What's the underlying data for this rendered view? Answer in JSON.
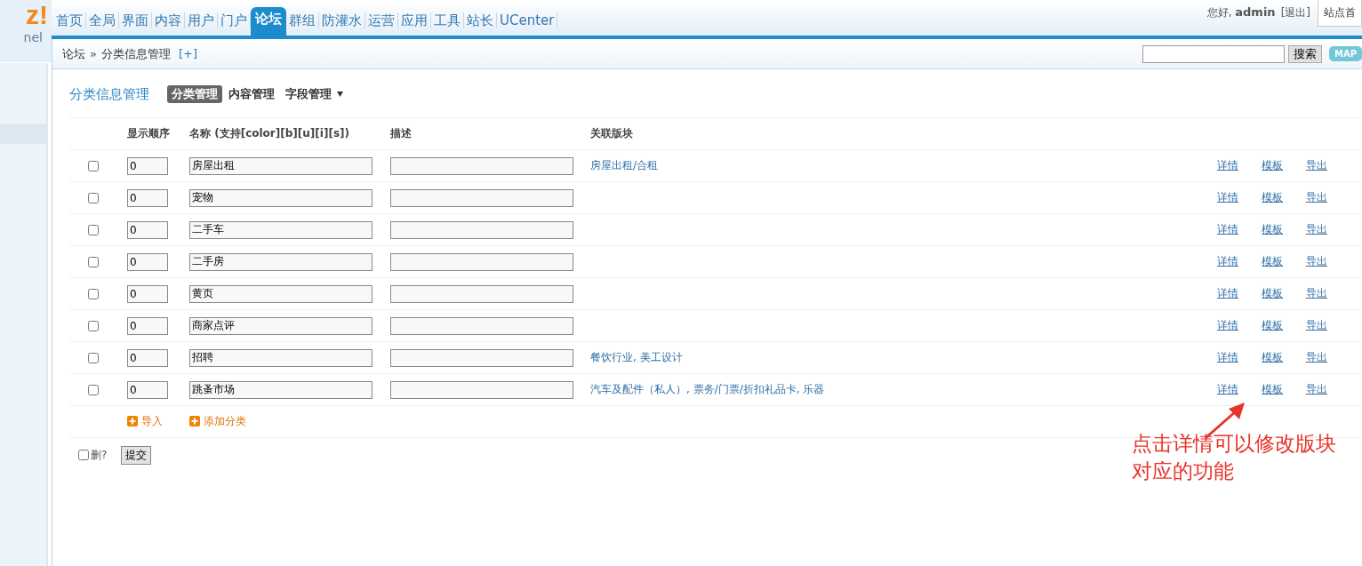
{
  "header": {
    "logo": "z!",
    "logo_subtitle": "nel",
    "nav": [
      {
        "label": "首页",
        "selected": false
      },
      {
        "label": "全局",
        "selected": false
      },
      {
        "label": "界面",
        "selected": false
      },
      {
        "label": "内容",
        "selected": false
      },
      {
        "label": "用户",
        "selected": false
      },
      {
        "label": "门户",
        "selected": false
      },
      {
        "label": "论坛",
        "selected": true
      },
      {
        "label": "群组",
        "selected": false
      },
      {
        "label": "防灌水",
        "selected": false
      },
      {
        "label": "运营",
        "selected": false
      },
      {
        "label": "应用",
        "selected": false
      },
      {
        "label": "工具",
        "selected": false
      },
      {
        "label": "站长",
        "selected": false
      },
      {
        "label": "UCenter",
        "selected": false
      }
    ],
    "greeting": "您好,",
    "user": "admin",
    "logout": "[退出]",
    "site_home": "站点首"
  },
  "breadcrumb": {
    "items": [
      "论坛",
      "分类信息管理"
    ],
    "separator": "»",
    "add": "[+]"
  },
  "search": {
    "button": "搜索",
    "map": "MAP"
  },
  "page": {
    "title": "分类信息管理",
    "tabs": [
      {
        "label": "分类管理",
        "selected": true,
        "dropdown": false
      },
      {
        "label": "内容管理",
        "selected": false,
        "dropdown": false
      },
      {
        "label": "字段管理",
        "selected": false,
        "dropdown": true
      }
    ]
  },
  "table": {
    "columns": [
      "显示顺序",
      "**名称** (支持[color][b][u][i][s])",
      "描述",
      "关联版块"
    ],
    "rows": [
      {
        "checked": false,
        "order": "0",
        "name": "房屋出租",
        "forums": "房屋出租/合租",
        "actions": [
          "详情",
          "模板",
          "导出"
        ]
      },
      {
        "checked": false,
        "order": "0",
        "name": "宠物",
        "actions": [
          "详情",
          "模板",
          "导出"
        ]
      },
      {
        "checked": false,
        "order": "0",
        "name": "二手车",
        "actions": [
          "详情",
          "模板",
          "导出"
        ]
      },
      {
        "checked": false,
        "order": "0",
        "name": "二手房",
        "actions": [
          "详情",
          "模板",
          "导出"
        ]
      },
      {
        "checked": false,
        "order": "0",
        "name": "黄页",
        "actions": [
          "详情",
          "模板",
          "导出"
        ]
      },
      {
        "checked": false,
        "order": "0",
        "name": "商家点评",
        "actions": [
          "详情",
          "模板",
          "导出"
        ]
      },
      {
        "checked": false,
        "order": "0",
        "name": "招聘",
        "forums": "餐饮行业, 美工设计",
        "actions": [
          "详情",
          "模板",
          "导出"
        ]
      },
      {
        "checked": false,
        "order": "0",
        "name": "跳蚤市场",
        "forums": "汽车及配件（私人）, 票务/门票/折扣礼品卡, 乐器",
        "actions": [
          "详情",
          "模板",
          "导出"
        ]
      }
    ],
    "add_links": [
      "导入",
      "添加分类"
    ],
    "delete_label": "删?",
    "delete_checked": false,
    "submit": "提交"
  },
  "annotation": {
    "lines": [
      "点击详情可以修改版块",
      "对应的功能"
    ]
  }
}
